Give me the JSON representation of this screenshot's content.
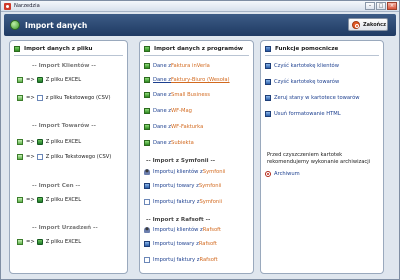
{
  "window": {
    "title": "Narzedzia"
  },
  "header": {
    "title": "Import danych",
    "close_label": "Zakończ"
  },
  "panel1": {
    "title": "Import danych z pliku",
    "sections": [
      {
        "label": "-- Import Klientów --",
        "items": [
          {
            "prefix": "=>",
            "label": "Z pliku EXCEL"
          },
          {
            "prefix": "=>",
            "label": "z pliku Tekstowego (CSV)"
          }
        ]
      },
      {
        "label": "-- Import Towarów --",
        "items": [
          {
            "prefix": "=>",
            "label": "Z pliku EXCEL"
          },
          {
            "prefix": "=>",
            "label": "Z pliku Tekstowego (CSV)"
          }
        ]
      },
      {
        "label": "-- Import Cen --",
        "items": [
          {
            "prefix": "=>",
            "label": "Z pliku EXCEL"
          }
        ]
      },
      {
        "label": "-- Import Urzadzeń --",
        "items": [
          {
            "prefix": "=>",
            "label": "Z pliku EXCEL"
          }
        ]
      }
    ]
  },
  "panel2": {
    "title": "Import danych z programów",
    "items": [
      {
        "pre": "Dane z ",
        "src": "Faktura inVerla"
      },
      {
        "pre": "Dane z ",
        "src": "Faktury-Biuro (Wesoła)"
      },
      {
        "pre": "Dane z ",
        "src": "Small Business"
      },
      {
        "pre": "Dane z ",
        "src": "WF-Mag"
      },
      {
        "pre": "Dane z ",
        "src": "WF-Fakturka"
      },
      {
        "pre": "Dane z ",
        "src": "Subiekta"
      }
    ],
    "symfonia": {
      "label": "-- Import z Symfonii --",
      "items": [
        {
          "pre": "Importuj klientów z ",
          "src": "Symfonii"
        },
        {
          "pre": "Importuj towary z ",
          "src": "Symfonii"
        },
        {
          "pre": "Importuj faktury z ",
          "src": "Symfonii"
        }
      ]
    },
    "rafsoft": {
      "label": "-- Import z Rafsoft --",
      "items": [
        {
          "pre": "Importuj klientów z ",
          "src": "Rafsoft"
        },
        {
          "pre": "Importuj towary z ",
          "src": "Rafsoft"
        },
        {
          "pre": "Importuj faktury z ",
          "src": "Rafsoft"
        }
      ]
    }
  },
  "panel3": {
    "title": "Funkcje pomocnicze",
    "items": [
      "Czyść kartotekę klientów",
      "Czyść kartotekę towarów",
      "Zeruj stany w kartotece towarów",
      "Usuń formatowanie HTML"
    ],
    "note": "Przed czyszczeniem kartotek rekomendujemy wykonanie archiwizacji",
    "archive_label": "Archiwum"
  },
  "colors": {
    "header_bg": "#2a4670",
    "link_blue": "#1c3f8f",
    "source_orange": "#d2691e"
  }
}
